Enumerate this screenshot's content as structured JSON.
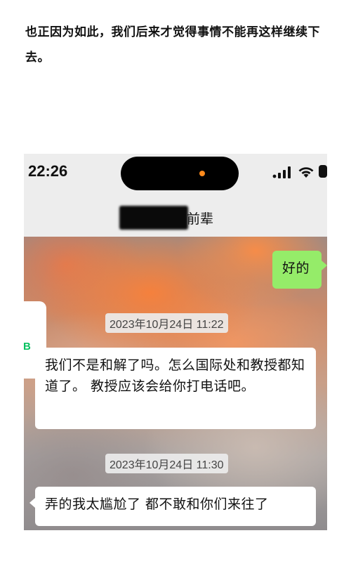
{
  "article": {
    "paragraph": "也正因为如此，我们后来才觉得事情不能再这样继续下去。"
  },
  "status_bar": {
    "time": "22:26",
    "icons": [
      "cellular-signal-icon",
      "wifi-icon",
      "battery-icon"
    ]
  },
  "chat_header": {
    "contact_name": "前辈"
  },
  "overlay": {
    "letter": "B"
  },
  "messages": [
    {
      "direction": "outgoing",
      "text": "好的"
    },
    {
      "timestamp": "2023年10月24日 11:22"
    },
    {
      "direction": "incoming",
      "text": "我们不是和解了吗。怎么国际处和教授都知道了。 教授应该会给你打电话吧。"
    },
    {
      "timestamp": "2023年10月24日 11:30"
    },
    {
      "direction": "incoming",
      "text": "弄的我太尴尬了 都不敢和你们来往了"
    }
  ],
  "colors": {
    "outgoing_bubble": "#95ec69",
    "incoming_bubble": "#ffffff",
    "island_dot": "#ff8a1c",
    "accent_green": "#07c160"
  }
}
